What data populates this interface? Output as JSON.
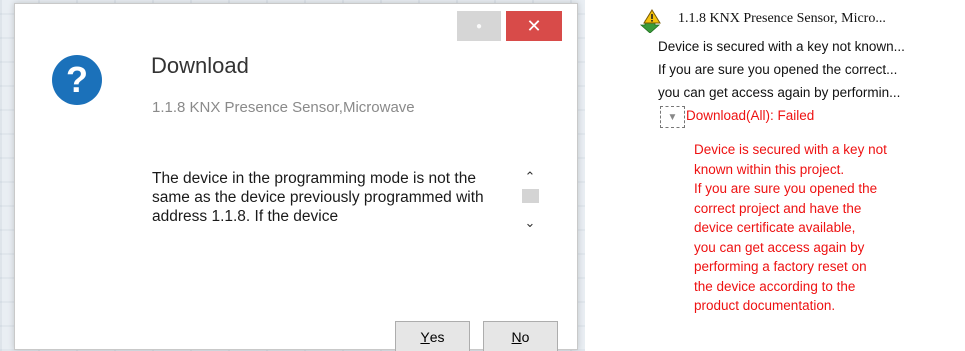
{
  "dialog": {
    "title": "Download",
    "subtitle": "1.1.8 KNX Presence Sensor,Microwave",
    "message": "The device in the programming mode is not the same as the device previously programmed with address 1.1.8. If the device",
    "close_glyph": "✕",
    "min_glyph": "●",
    "yes_hotkey": "Y",
    "yes_rest": "es",
    "no_hotkey": "N",
    "no_rest": "o",
    "icon": "question-icon"
  },
  "log": {
    "title": "1.1.8 KNX Presence Sensor, Micro...",
    "lines": [
      "Device is secured with a key not known...",
      "If you are sure you opened the correct...",
      "you can get access again by performin..."
    ],
    "failed_label": "Download(All): Failed",
    "detail_lines": [
      "Device is secured with a key not",
      "known within this project.",
      "If you are sure you opened the",
      "correct project and have the",
      "device certificate available,",
      "you can get access again by",
      "performing a factory reset on",
      "the device according to the",
      "product documentation."
    ],
    "icon": "warning-download-icon"
  },
  "colors": {
    "close": "#d84b49",
    "question": "#1b71ba",
    "error": "#ee1111"
  }
}
